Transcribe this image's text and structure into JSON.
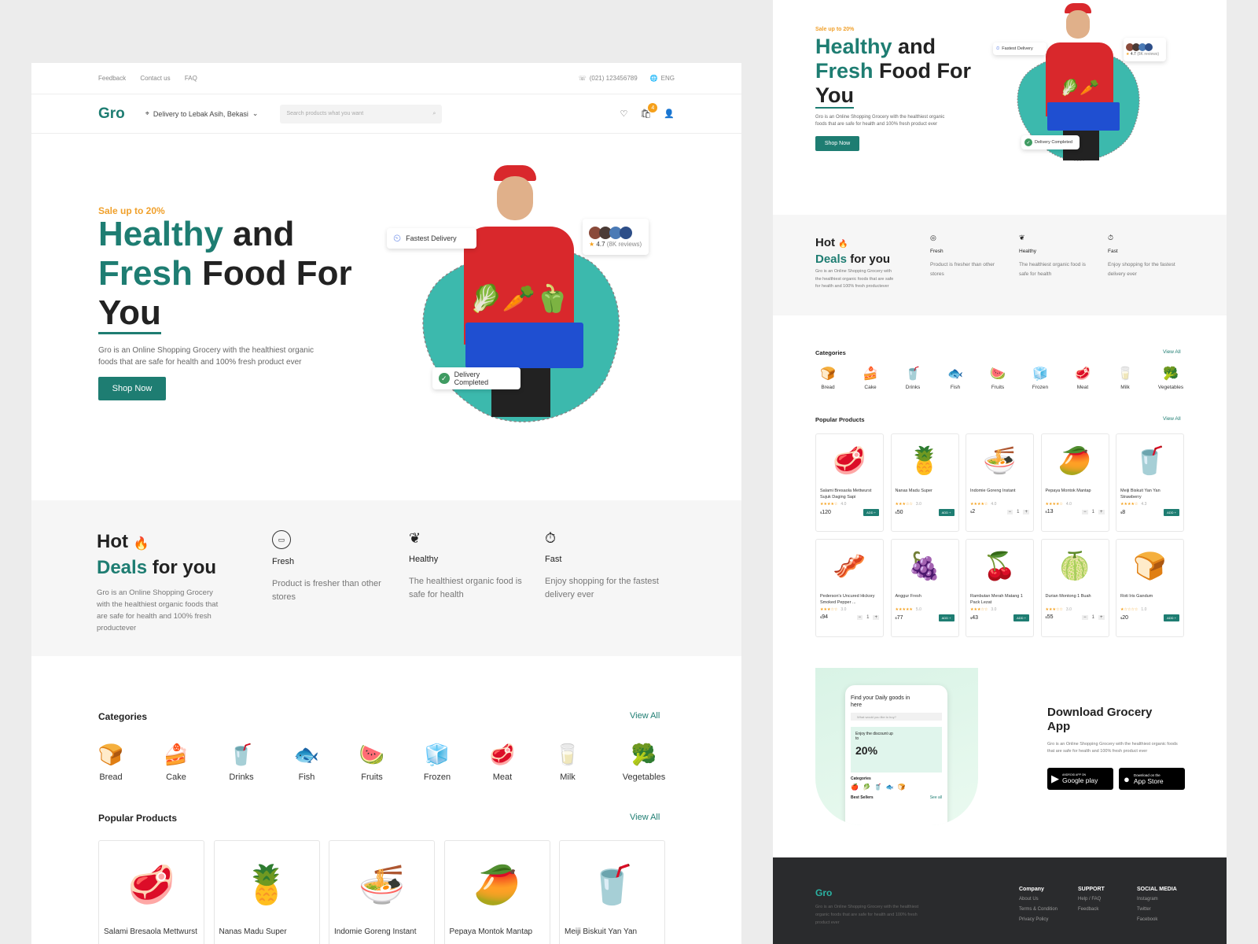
{
  "top": {
    "links": [
      "Feedback",
      "Contact us",
      "FAQ"
    ],
    "phone": "(021) 123456789",
    "lang": "ENG"
  },
  "nav": {
    "logo": "Gro",
    "delivery": "Delivery to Lebak Asih, Bekasi",
    "search_placeholder": "Search products what you want",
    "cart_count": "4"
  },
  "hero": {
    "sale": "Sale up to 20%",
    "title_a": "Healthy",
    "title_b": " and",
    "title_c": "Fresh",
    "title_d": " Food For",
    "title_e": "You",
    "desc": "Gro is an Online Shopping Grocery with the healthiest organic foods that are safe for health and 100% fresh product ever",
    "button": "Shop Now",
    "fastest": "Fastest Delivery",
    "rating": "4.7",
    "reviews": "(8K reviews)",
    "completed": "Delivery Completed"
  },
  "deals": {
    "hot": "Hot",
    "deals": "Deals",
    "for": " for you",
    "desc": "Gro is an Online Shopping Grocery with the healthiest organic foods that are safe for health and 100% fresh productever",
    "features": [
      {
        "icon": "fresh-icon",
        "title": "Fresh",
        "text": "Product is fresher than other stores"
      },
      {
        "icon": "healthy-icon",
        "title": "Healthy",
        "text": "The healthiest organic food is safe for health"
      },
      {
        "icon": "fast-icon",
        "title": "Fast",
        "text": "Enjoy shopping for the fastest delivery ever"
      }
    ]
  },
  "categories": {
    "title": "Categories",
    "view_all": "View All",
    "items": [
      {
        "label": "Bread",
        "icon": "🍞"
      },
      {
        "label": "Cake",
        "icon": "🍰"
      },
      {
        "label": "Drinks",
        "icon": "🥤"
      },
      {
        "label": "Fish",
        "icon": "🐟"
      },
      {
        "label": "Fruits",
        "icon": "🍉"
      },
      {
        "label": "Frozen",
        "icon": "🧊"
      },
      {
        "label": "Meat",
        "icon": "🥩"
      },
      {
        "label": "Milk",
        "icon": "🥛"
      },
      {
        "label": "Vegetables",
        "icon": "🥦"
      }
    ]
  },
  "popular": {
    "title": "Popular Products",
    "view_all": "View All",
    "items": [
      {
        "name": "Salami Bresaola Mettwurst",
        "full": "Salami Bresaola Mettwurst Sujuk Daging Sapi",
        "icon": "🥩",
        "price": "120",
        "rating": "4.0",
        "stars": "★★★★☆",
        "qty": "",
        "add": "ADD +"
      },
      {
        "name": "Nanas Madu Super",
        "full": "Nanas Madu Super",
        "icon": "🍍",
        "price": "50",
        "rating": "3.0",
        "stars": "★★★☆☆",
        "qty": "",
        "add": "ADD +"
      },
      {
        "name": "Indomie Goreng Instant",
        "full": "Indomie Goreng Instant",
        "icon": "🍜",
        "price": "2",
        "rating": "4.0",
        "stars": "★★★★☆",
        "qty": "1",
        "add": ""
      },
      {
        "name": "Pepaya Montok Mantap",
        "full": "Pepaya Montok Mantap",
        "icon": "🥭",
        "price": "13",
        "rating": "4.0",
        "stars": "★★★★☆",
        "qty": "1",
        "add": ""
      },
      {
        "name": "Meiji Biskuit Yan Yan",
        "full": "Meiji Biskuit Yan Yan Strawberry",
        "icon": "🥤",
        "price": "8",
        "rating": "4.3",
        "stars": "★★★★☆",
        "qty": "",
        "add": "ADD +"
      },
      {
        "name": "",
        "full": "Pederson's Uncured Hickory Smoked Pepper ...",
        "icon": "🥓",
        "price": "94",
        "rating": "3.0",
        "stars": "★★★☆☆",
        "qty": "1",
        "add": ""
      },
      {
        "name": "",
        "full": "Anggur Fresh",
        "icon": "🍇",
        "price": "77",
        "rating": "5.0",
        "stars": "★★★★★",
        "qty": "",
        "add": "ADD +"
      },
      {
        "name": "",
        "full": "Rambutan Merah Matang 1 Pack Lezat",
        "icon": "🍒",
        "price": "43",
        "rating": "3.0",
        "stars": "★★★☆☆",
        "qty": "",
        "add": "ADD +"
      },
      {
        "name": "",
        "full": "Durian Montong 1 Buah",
        "icon": "🍈",
        "price": "55",
        "rating": "3.0",
        "stars": "★★★☆☆",
        "qty": "1",
        "add": ""
      },
      {
        "name": "",
        "full": "Roti Iris Gandum",
        "icon": "🍞",
        "price": "20",
        "rating": "1.0",
        "stars": "★☆☆☆☆",
        "qty": "",
        "add": "ADD +"
      }
    ]
  },
  "app": {
    "title": "Download Grocery App",
    "desc": "Gro is an Online Shopping Grocery with the healthiest organic foods that are safe for health and 100% fresh product ever",
    "google_small": "ANDROID APP ON",
    "google": "Google play",
    "apple_small": "Download on the",
    "apple": "App Store",
    "phone_title": "Find your Daily goods in here",
    "phone_search": "What would you like to buy?",
    "phone_promo": "Enjoy the discount up to",
    "phone_pct": "20%",
    "phone_cats": "Categories",
    "phone_best": "Best Sellers",
    "phone_see": "See all"
  },
  "footer": {
    "logo": "Gro",
    "desc": "Gro is an Online Shopping Grocery with the healthiest organic foods that are safe for health and 100% fresh product ever",
    "company": "Company",
    "company_links": [
      "About Us",
      "Terms & Condition",
      "Privacy Policy"
    ],
    "support": "SUPPORT",
    "support_links": [
      "Help / FAQ",
      "Feedback"
    ],
    "social": "SOCIAL MEDIA",
    "social_links": [
      "Instagram",
      "Twitter",
      "Facebook"
    ]
  },
  "colors": {
    "accent": "#1e7d72",
    "orange": "#f0a02b",
    "blob": "#3cb9ad"
  }
}
